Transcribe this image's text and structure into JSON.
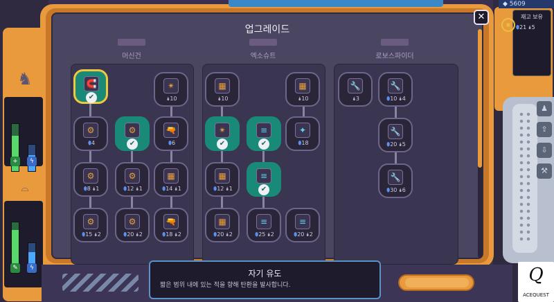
{
  "header": {
    "title": "업그레이드"
  },
  "currency": {
    "gems": "5609"
  },
  "stock": {
    "title": "재고 보유",
    "gems": "21",
    "drops": "5"
  },
  "close": {
    "label": "✕"
  },
  "columns": [
    {
      "label": "머신건"
    },
    {
      "label": "엑소슈트"
    },
    {
      "label": "로보스파이더"
    }
  ],
  "nodes": {
    "mg1": {
      "icon": "🧲",
      "cost": ""
    },
    "mg2": {
      "icon": "✴",
      "cost": "10"
    },
    "mg3": {
      "icon": "⚙",
      "gems": "4"
    },
    "mg4": {
      "icon": "⚙",
      "cost": ""
    },
    "mg5": {
      "icon": "🔫",
      "gems": "6"
    },
    "mg6": {
      "icon": "⚙",
      "gems": "8",
      "drops": "1"
    },
    "mg7": {
      "icon": "⚙",
      "gems": "12",
      "drops": "1"
    },
    "mg8": {
      "icon": "▦",
      "gems": "14",
      "drops": "1"
    },
    "mg9": {
      "icon": "⚙",
      "gems": "15",
      "drops": "2"
    },
    "mg10": {
      "icon": "⚙",
      "gems": "20",
      "drops": "2"
    },
    "mg11": {
      "icon": "🔫",
      "gems": "18",
      "drops": "2"
    },
    "ex1": {
      "icon": "▦",
      "cost": "10"
    },
    "ex2": {
      "icon": "▦",
      "cost": "10"
    },
    "ex3": {
      "icon": "✴",
      "cost": ""
    },
    "ex4": {
      "icon": "≡",
      "cost": ""
    },
    "ex5": {
      "icon": "✦",
      "gems": "18"
    },
    "ex6": {
      "icon": "▦",
      "gems": "12",
      "drops": "1"
    },
    "ex7": {
      "icon": "≡",
      "cost": ""
    },
    "ex8": {
      "icon": "▦",
      "gems": "20",
      "drops": "2"
    },
    "ex9": {
      "icon": "≡",
      "gems": "25",
      "drops": "2"
    },
    "ex10": {
      "icon": "≡",
      "gems": "20",
      "drops": "2"
    },
    "rs1": {
      "icon": "🔧",
      "cost": "3"
    },
    "rs2": {
      "icon": "🔧",
      "gems": "10",
      "drops": "4"
    },
    "rs3": {
      "icon": "🔧",
      "gems": "20",
      "drops": "5"
    },
    "rs4": {
      "icon": "🔧",
      "gems": "30",
      "drops": "6"
    }
  },
  "info": {
    "title": "자기 유도",
    "desc": "짧은 범위 내에 있는 적을 향해 탄환을 발사합니다."
  },
  "logo": {
    "mark": "Q",
    "text": "ACEQUEST"
  },
  "gauges": {
    "top_green_level": 0.75,
    "top_blue_level": 0.6,
    "bottom_green_level": 0.85,
    "bottom_blue_level": 0.7
  },
  "icons": {
    "close": "close-icon",
    "check": "check-icon",
    "gem": "gem-icon",
    "drop": "drop-icon"
  }
}
